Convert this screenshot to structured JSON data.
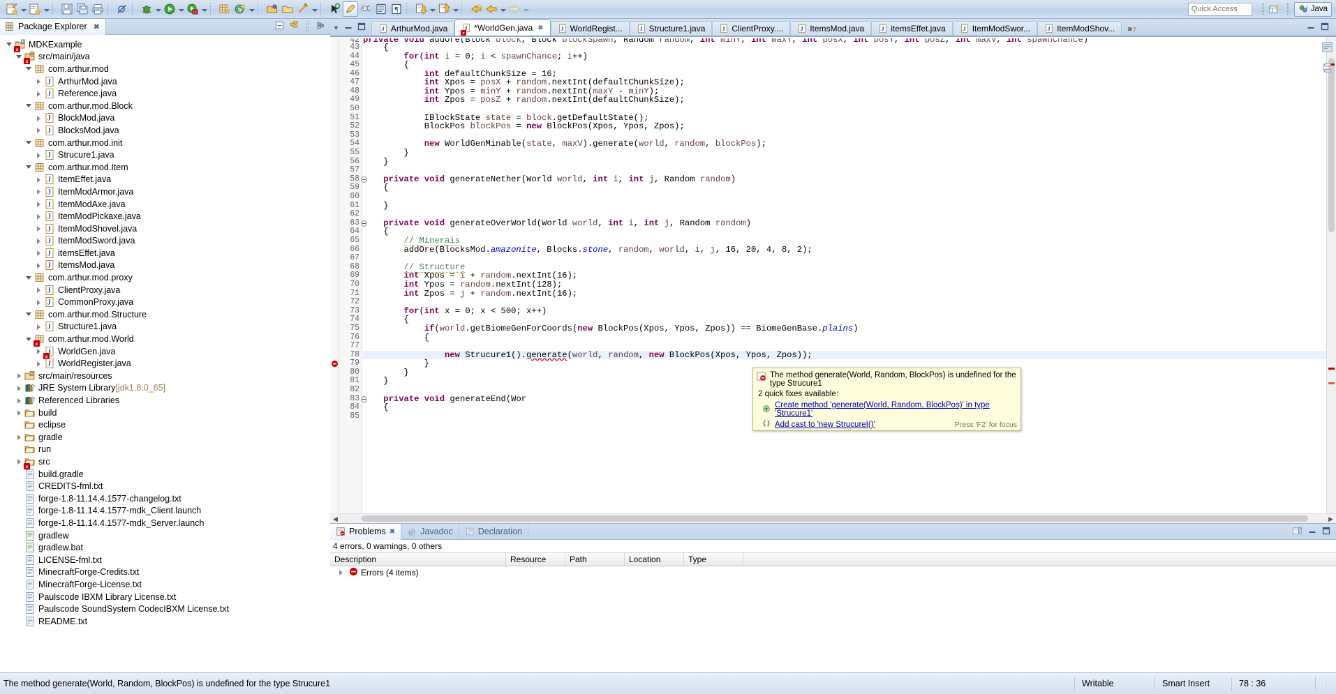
{
  "window": {
    "quick_access_placeholder": "Quick Access",
    "perspective_label": "Java"
  },
  "toolbar": {
    "items": [
      {
        "name": "new-wizard-icon",
        "label": "New"
      },
      {
        "name": "new-wizard-dropdown",
        "label": ""
      },
      {
        "name": "new-java-class-icon",
        "label": "New Java Class"
      },
      {
        "name": "new-java-class-dropdown",
        "label": ""
      },
      {
        "name": "save-icon",
        "label": "Save"
      },
      {
        "name": "save-all-icon",
        "label": "Save All"
      },
      {
        "name": "print-icon",
        "label": "Print"
      },
      {
        "name": "toggle-breakpoint-icon",
        "label": "Skip All Breakpoints"
      },
      {
        "name": "debug-icon",
        "label": "Debug"
      },
      {
        "name": "debug-dropdown",
        "label": ""
      },
      {
        "name": "run-icon",
        "label": "Run"
      },
      {
        "name": "run-dropdown",
        "label": ""
      },
      {
        "name": "external-tools-icon",
        "label": "External Tools"
      },
      {
        "name": "external-tools-dropdown",
        "label": ""
      },
      {
        "name": "new-package-icon",
        "label": "New Java Package"
      },
      {
        "name": "new-annotation-icon",
        "label": "New Annotation"
      },
      {
        "name": "new-annotation-dropdown",
        "label": ""
      },
      {
        "name": "open-type-icon",
        "label": "Open Type"
      },
      {
        "name": "open-task-icon",
        "label": "Open Task"
      },
      {
        "name": "search-icon",
        "label": "Search"
      },
      {
        "name": "search-dropdown",
        "label": ""
      },
      {
        "name": "link-editor-icon",
        "label": "Link with Editor"
      },
      {
        "name": "pencil-highlight-icon",
        "label": "Toggle Mark Occurrences"
      },
      {
        "name": "coverage-icon",
        "label": "Coverage"
      },
      {
        "name": "show-whitespace-icon",
        "label": "Show Whitespace Characters"
      },
      {
        "name": "pilcrow-icon",
        "label": "Show Formatting"
      },
      {
        "name": "next-annotation-icon",
        "label": "Next Annotation"
      },
      {
        "name": "next-annotation-dropdown",
        "label": ""
      },
      {
        "name": "previous-annotation-icon",
        "label": "Previous Annotation"
      },
      {
        "name": "previous-annotation-dropdown",
        "label": ""
      },
      {
        "name": "last-edit-location-icon",
        "label": "Back to last edit location"
      },
      {
        "name": "back-icon",
        "label": "Back"
      },
      {
        "name": "back-dropdown",
        "label": ""
      },
      {
        "name": "forward-icon",
        "label": "Forward"
      },
      {
        "name": "forward-dropdown",
        "label": ""
      }
    ]
  },
  "explorer": {
    "title": "Package Explorer",
    "tools": [
      "collapse-all-icon",
      "link-with-editor-icon",
      "view-menu-icon"
    ],
    "tree": [
      {
        "depth": 0,
        "twisty": "open",
        "icon": "java-project",
        "label": "MDKExample",
        "error": true
      },
      {
        "depth": 1,
        "twisty": "open",
        "icon": "source-folder",
        "label": "src/main/java",
        "error": true
      },
      {
        "depth": 2,
        "twisty": "open",
        "icon": "package",
        "label": "com.arthur.mod"
      },
      {
        "depth": 3,
        "twisty": "closed",
        "icon": "java-file",
        "label": "ArthurMod.java"
      },
      {
        "depth": 3,
        "twisty": "closed",
        "icon": "java-file",
        "label": "Reference.java"
      },
      {
        "depth": 2,
        "twisty": "open",
        "icon": "package",
        "label": "com.arthur.mod.Block"
      },
      {
        "depth": 3,
        "twisty": "closed",
        "icon": "java-file",
        "label": "BlockMod.java"
      },
      {
        "depth": 3,
        "twisty": "closed",
        "icon": "java-file",
        "label": "BlocksMod.java"
      },
      {
        "depth": 2,
        "twisty": "open",
        "icon": "package",
        "label": "com.arthur.mod.init"
      },
      {
        "depth": 3,
        "twisty": "closed",
        "icon": "java-file",
        "label": "Strucure1.java"
      },
      {
        "depth": 2,
        "twisty": "open",
        "icon": "package",
        "label": "com.arthur.mod.Item"
      },
      {
        "depth": 3,
        "twisty": "closed",
        "icon": "java-file",
        "label": "ItemEffet.java"
      },
      {
        "depth": 3,
        "twisty": "closed",
        "icon": "java-file",
        "label": "ItemModArmor.java"
      },
      {
        "depth": 3,
        "twisty": "closed",
        "icon": "java-file",
        "label": "ItemModAxe.java"
      },
      {
        "depth": 3,
        "twisty": "closed",
        "icon": "java-file",
        "label": "ItemModPickaxe.java"
      },
      {
        "depth": 3,
        "twisty": "closed",
        "icon": "java-file",
        "label": "ItemModShovel.java"
      },
      {
        "depth": 3,
        "twisty": "closed",
        "icon": "java-file",
        "label": "ItemModSword.java"
      },
      {
        "depth": 3,
        "twisty": "closed",
        "icon": "java-file",
        "label": "itemsEffet.java"
      },
      {
        "depth": 3,
        "twisty": "closed",
        "icon": "java-file",
        "label": "ItemsMod.java"
      },
      {
        "depth": 2,
        "twisty": "open",
        "icon": "package",
        "label": "com.arthur.mod.proxy"
      },
      {
        "depth": 3,
        "twisty": "closed",
        "icon": "java-file",
        "label": "ClientProxy.java"
      },
      {
        "depth": 3,
        "twisty": "closed",
        "icon": "java-file",
        "label": "CommonProxy.java"
      },
      {
        "depth": 2,
        "twisty": "open",
        "icon": "package",
        "label": "com.arthur.mod.Structure"
      },
      {
        "depth": 3,
        "twisty": "closed",
        "icon": "java-file",
        "label": "Structure1.java"
      },
      {
        "depth": 2,
        "twisty": "open",
        "icon": "package",
        "label": "com.arthur.mod.World",
        "error": true
      },
      {
        "depth": 3,
        "twisty": "closed",
        "icon": "java-file",
        "label": "WorldGen.java",
        "error": true
      },
      {
        "depth": 3,
        "twisty": "closed",
        "icon": "java-file",
        "label": "WorldRegister.java"
      },
      {
        "depth": 1,
        "twisty": "closed",
        "icon": "source-folder",
        "label": "src/main/resources"
      },
      {
        "depth": 1,
        "twisty": "closed",
        "icon": "library",
        "label": "JRE System Library",
        "suffix": "[jdk1.8.0_65]"
      },
      {
        "depth": 1,
        "twisty": "closed",
        "icon": "library",
        "label": "Referenced Libraries"
      },
      {
        "depth": 1,
        "twisty": "closed",
        "icon": "folder",
        "label": "build"
      },
      {
        "depth": 1,
        "twisty": "none",
        "icon": "folder",
        "label": "eclipse"
      },
      {
        "depth": 1,
        "twisty": "closed",
        "icon": "folder",
        "label": "gradle"
      },
      {
        "depth": 1,
        "twisty": "none",
        "icon": "folder",
        "label": "run"
      },
      {
        "depth": 1,
        "twisty": "closed",
        "icon": "folder",
        "label": "src",
        "error": true
      },
      {
        "depth": 1,
        "twisty": "none",
        "icon": "file",
        "label": "build.gradle"
      },
      {
        "depth": 1,
        "twisty": "none",
        "icon": "file",
        "label": "CREDITS-fml.txt"
      },
      {
        "depth": 1,
        "twisty": "none",
        "icon": "file",
        "label": "forge-1.8-11.14.4.1577-changelog.txt"
      },
      {
        "depth": 1,
        "twisty": "none",
        "icon": "file",
        "label": "forge-1.8-11.14.4.1577-mdk_Client.launch"
      },
      {
        "depth": 1,
        "twisty": "none",
        "icon": "file",
        "label": "forge-1.8-11.14.4.1577-mdk_Server.launch"
      },
      {
        "depth": 1,
        "twisty": "none",
        "icon": "file-script",
        "label": "gradlew"
      },
      {
        "depth": 1,
        "twisty": "none",
        "icon": "file-script",
        "label": "gradlew.bat"
      },
      {
        "depth": 1,
        "twisty": "none",
        "icon": "file",
        "label": "LICENSE-fml.txt"
      },
      {
        "depth": 1,
        "twisty": "none",
        "icon": "file",
        "label": "MinecraftForge-Credits.txt"
      },
      {
        "depth": 1,
        "twisty": "none",
        "icon": "file",
        "label": "MinecraftForge-License.txt"
      },
      {
        "depth": 1,
        "twisty": "none",
        "icon": "file",
        "label": "Paulscode IBXM Library License.txt"
      },
      {
        "depth": 1,
        "twisty": "none",
        "icon": "file",
        "label": "Paulscode SoundSystem CodecIBXM License.txt"
      },
      {
        "depth": 1,
        "twisty": "none",
        "icon": "file",
        "label": "README.txt"
      }
    ]
  },
  "editor": {
    "tabs": [
      {
        "label": "ArthurMod.java",
        "active": false,
        "dirty": false,
        "error": false
      },
      {
        "label": "*WorldGen.java",
        "active": true,
        "dirty": true,
        "error": true
      },
      {
        "label": "WorldRegist...",
        "active": false,
        "dirty": false,
        "error": false
      },
      {
        "label": "Structure1.java",
        "active": false,
        "dirty": false,
        "error": false
      },
      {
        "label": "ClientProxy....",
        "active": false,
        "dirty": false,
        "error": false
      },
      {
        "label": "ItemsMod.java",
        "active": false,
        "dirty": false,
        "error": false
      },
      {
        "label": "itemsEffet.java",
        "active": false,
        "dirty": false,
        "error": false
      },
      {
        "label": "ItemModSwor...",
        "active": false,
        "dirty": false,
        "error": false
      },
      {
        "label": "ItemModShov...",
        "active": false,
        "dirty": false,
        "error": false
      }
    ],
    "overflow_count": "7",
    "overflow_symbol": "»",
    "first_partial_line": "private void addOre(Block block, Block blockSpawn, Random random, int minY, int maxY, int posX, int posY, int posZ, int maxV, int spawnChance)",
    "lines": [
      {
        "n": 43,
        "text": "    {"
      },
      {
        "n": 44,
        "text": "        for(int i = 0; i < spawnChance; i++)"
      },
      {
        "n": 45,
        "text": "        {"
      },
      {
        "n": 46,
        "text": "            int defaultChunkSize = 16;"
      },
      {
        "n": 47,
        "text": "            int Xpos = posX + random.nextInt(defaultChunkSize);"
      },
      {
        "n": 48,
        "text": "            int Ypos = minY + random.nextInt(maxY - minY);"
      },
      {
        "n": 49,
        "text": "            int Zpos = posZ + random.nextInt(defaultChunkSize);"
      },
      {
        "n": 50,
        "text": ""
      },
      {
        "n": 51,
        "text": "            IBlockState state = block.getDefaultState();"
      },
      {
        "n": 52,
        "text": "            BlockPos blockPos = new BlockPos(Xpos, Ypos, Zpos);"
      },
      {
        "n": 53,
        "text": ""
      },
      {
        "n": 54,
        "text": "            new WorldGenMinable(state, maxV).generate(world, random, blockPos);"
      },
      {
        "n": 55,
        "text": "        }"
      },
      {
        "n": 56,
        "text": "    }"
      },
      {
        "n": 57,
        "text": ""
      },
      {
        "n": 58,
        "text": "    private void generateNether(World world, int i, int j, Random random)",
        "fold": true
      },
      {
        "n": 59,
        "text": "    {"
      },
      {
        "n": 60,
        "text": ""
      },
      {
        "n": 61,
        "text": "    }"
      },
      {
        "n": 62,
        "text": ""
      },
      {
        "n": 63,
        "text": "    private void generateOverWorld(World world, int i, int j, Random random)",
        "fold": true,
        "changed": true
      },
      {
        "n": 64,
        "text": "    {",
        "changed": true
      },
      {
        "n": 65,
        "text": "        // Minerais",
        "changed": true
      },
      {
        "n": 66,
        "text": "        addOre(BlocksMod.amazonite, Blocks.stone, random, world, i, j, 16, 20, 4, 8, 2);",
        "changed": true
      },
      {
        "n": 67,
        "text": "",
        "changed": true
      },
      {
        "n": 68,
        "text": "        // Structure",
        "changed": true
      },
      {
        "n": 69,
        "text": "        int Xpos = i + random.nextInt(16);",
        "changed": true
      },
      {
        "n": 70,
        "text": "        int Ypos = random.nextInt(128);",
        "changed": true
      },
      {
        "n": 71,
        "text": "        int Zpos = j + random.nextInt(16);",
        "changed": true
      },
      {
        "n": 72,
        "text": "",
        "changed": true
      },
      {
        "n": 73,
        "text": "        for(int x = 0; x < 500; x++)",
        "changed": true
      },
      {
        "n": 74,
        "text": "        {",
        "changed": true
      },
      {
        "n": 75,
        "text": "            if(world.getBiomeGenForCoords(new BlockPos(Xpos, Ypos, Zpos)) == BiomeGenBase.plains)",
        "changed": true
      },
      {
        "n": 76,
        "text": "            {",
        "changed": true
      },
      {
        "n": 77,
        "text": "",
        "changed": true
      },
      {
        "n": 78,
        "text": "                new Strucure1().generate(world, random, new BlockPos(Xpos, Ypos, Zpos));",
        "changed": true,
        "error": true,
        "highlight": true
      },
      {
        "n": 79,
        "text": "            }",
        "changed": true
      },
      {
        "n": 80,
        "text": "        }",
        "changed": true
      },
      {
        "n": 81,
        "text": "    }",
        "changed": true
      },
      {
        "n": 82,
        "text": "",
        "changed": true
      },
      {
        "n": 83,
        "text": "    private void generateEnd(Wor",
        "fold": true,
        "changed": true
      },
      {
        "n": 84,
        "text": "    {",
        "changed": true
      },
      {
        "n": 85,
        "text": "",
        "changed": true
      }
    ]
  },
  "error_popup": {
    "message": "The method generate(World, Random, BlockPos) is undefined for the type Strucure1",
    "subtitle": "2 quick fixes available:",
    "fixes": [
      {
        "icon": "create-method-icon",
        "label": "Create method 'generate(World, Random, BlockPos)' in type 'Strucure1'"
      },
      {
        "icon": "add-cast-icon",
        "label": "Add cast to 'new StrucureI()'"
      }
    ],
    "footer": "Press 'F2' for focus"
  },
  "problems": {
    "tabs": [
      {
        "label": "Problems",
        "active": true,
        "icon": "problems-icon",
        "closeable": true
      },
      {
        "label": "Javadoc",
        "active": false,
        "icon": "javadoc-icon",
        "closeable": false
      },
      {
        "label": "Declaration",
        "active": false,
        "icon": "declaration-icon",
        "closeable": false
      }
    ],
    "summary": "4 errors, 0 warnings, 0 others",
    "columns": [
      "Description",
      "Resource",
      "Path",
      "Location",
      "Type"
    ],
    "rows": [
      {
        "description": "Errors (4 items)",
        "resource": "",
        "path": "",
        "location": "",
        "type": "",
        "icon": "error-icon",
        "twisty": "closed"
      }
    ],
    "tools": [
      "filters-icon",
      "minimize-icon",
      "maximize-icon"
    ]
  },
  "statusbar": {
    "message": "The method generate(World, Random, BlockPos) is undefined for the type Strucure1",
    "writable": "Writable",
    "insert_mode": "Smart Insert",
    "position": "78 : 36"
  },
  "colors": {
    "keyword": "#7f0055",
    "string": "#2a00ff",
    "comment": "#3f7f5f",
    "field": "#0000c0",
    "error": "#d40000",
    "popup_bg": "#fdfddc",
    "selection": "#e8f2fe"
  }
}
